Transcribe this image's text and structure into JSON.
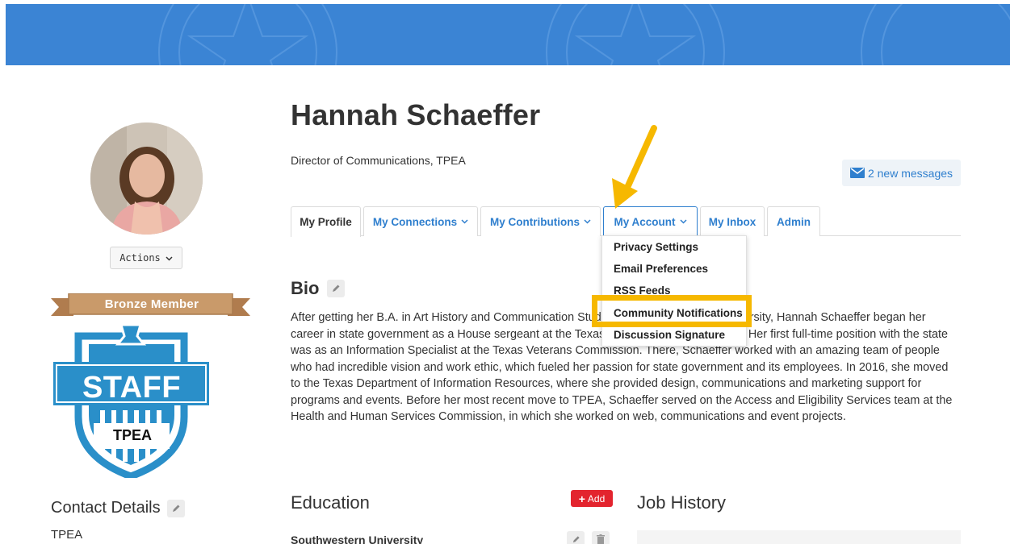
{
  "profile": {
    "name": "Hannah Schaeffer",
    "title": "Director of Communications, TPEA",
    "actions_label": "Actions",
    "membership_badge": "Bronze Member",
    "badge_staff": "STAFF",
    "badge_org": "TPEA"
  },
  "messages": {
    "label": "2 new messages"
  },
  "tabs": [
    {
      "label": "My Profile"
    },
    {
      "label": "My Connections"
    },
    {
      "label": "My Contributions"
    },
    {
      "label": "My Account"
    },
    {
      "label": "My Inbox"
    },
    {
      "label": "Admin"
    }
  ],
  "account_menu": {
    "items": [
      {
        "label": "Privacy Settings"
      },
      {
        "label": "Email Preferences"
      },
      {
        "label": "RSS Feeds"
      },
      {
        "label": "Community Notifications"
      },
      {
        "label": "Discussion Signature"
      }
    ]
  },
  "bio": {
    "heading": "Bio",
    "text": "After getting her B.A. in Art History and Communication Studies from Southwestern University, Hannah Schaeffer began her career in state government as a House sergeant at the Texas House of Representatives. Her first full-time position with the state was as an Information Specialist at the Texas Veterans Commission. There, Schaeffer worked with an amazing team of people who had incredible vision and work ethic, which fueled her passion for state government and its employees. In 2016, she moved to the Texas Department of Information Resources, where she provided design, communications and marketing support for programs and events. Before her most recent move to TPEA, Schaeffer served on the Access and Eligibility Services team at the Health and Human Services Commission, in which she worked on web, communications and event projects."
  },
  "contact": {
    "heading": "Contact Details",
    "organization": "TPEA"
  },
  "education": {
    "heading": "Education",
    "add_label": "Add",
    "entries": [
      {
        "school": "Southwestern University"
      }
    ]
  },
  "job_history": {
    "heading": "Job History"
  },
  "colors": {
    "banner": "#3b84d4",
    "link": "#2f7fce",
    "highlight": "#f6b800",
    "add_button": "#e3242e",
    "badge_blue": "#2a8fc9",
    "ribbon": "#c99a6a"
  }
}
